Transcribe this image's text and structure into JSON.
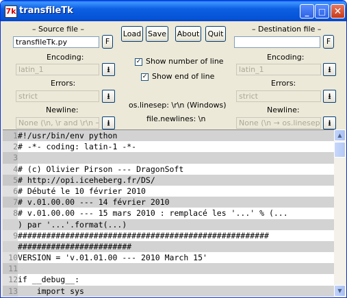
{
  "window": {
    "title": "transfileTk",
    "app_icon": "7k"
  },
  "source": {
    "header": "– Source file –",
    "file_value": "transfileTk.py",
    "file_button": "F",
    "encoding_label": "Encoding:",
    "encoding_value": "latin_1",
    "errors_label": "Errors:",
    "errors_value": "strict",
    "newline_label": "Newline:",
    "newline_value": "None  (\\n, \\r and \\r\\n → \\n)"
  },
  "destination": {
    "header": "– Destination file –",
    "file_value": "",
    "file_button": "F",
    "encoding_label": "Encoding:",
    "encoding_value": "latin_1",
    "errors_label": "Errors:",
    "errors_value": "strict",
    "newline_label": "Newline:",
    "newline_value": "None  (\\n → os.linesep)"
  },
  "buttons": {
    "load": "Load",
    "save": "Save",
    "about": "About",
    "quit": "Quit"
  },
  "options": {
    "show_number_label": "Show number of line",
    "show_number_checked": true,
    "show_end_label": "Show end of line",
    "show_end_checked": true,
    "os_linesep": "os.linesep: \\r\\n  (Windows)",
    "file_newlines": "file.newlines: \\n"
  },
  "download_icon": "⭳",
  "editor": {
    "lines": [
      {
        "n": "1",
        "t": "#!/usr/bin/env python"
      },
      {
        "n": "2",
        "t": "# -*- coding: latin-1 -*-"
      },
      {
        "n": "3",
        "t": ""
      },
      {
        "n": "4",
        "t": "# (c) Olivier Pirson --- DragonSoft"
      },
      {
        "n": "5",
        "t": "# http://opi.iceheberg.fr/DS/"
      },
      {
        "n": "6",
        "t": "# Débuté le 10 février 2010"
      },
      {
        "n": "7",
        "t": "# v.01.00.00 --- 14 février 2010"
      },
      {
        "n": "8",
        "t": "# v.01.00.00 --- 15 mars 2010 : remplacé les '...' % (..."
      },
      {
        "n": "",
        "t": ") par '...'.format(...)"
      },
      {
        "n": "9",
        "t": "#####################################################"
      },
      {
        "n": "",
        "t": "########################"
      },
      {
        "n": "10",
        "t": "VERSION = 'v.01.01.00 --- 2010 March 15'"
      },
      {
        "n": "11",
        "t": ""
      },
      {
        "n": "12",
        "t": "if __debug__:"
      },
      {
        "n": "13",
        "t": "    import sys"
      }
    ]
  }
}
